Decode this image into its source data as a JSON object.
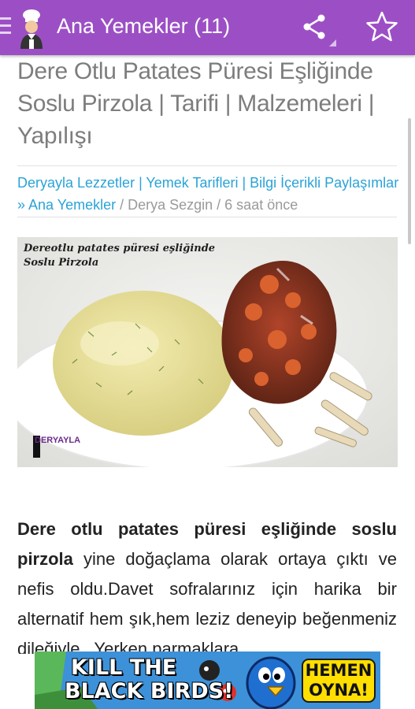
{
  "app": {
    "title": "Ana Yemekler (11)"
  },
  "article": {
    "title": "Dere Otlu Patates Püresi Eşliğinde Soslu Pirzola | Tarifi | Malzemeleri | Yapılışı",
    "meta_link": "Deryayla Lezzetler | Yemek Tarifleri | Bilgi İçerikli Paylaşımlar » Ana Yemekler",
    "meta_rest": " / Derya Sezgin / 6 saat önce",
    "photo": {
      "caption_line1": "Dereotlu patates püresi eşliğinde",
      "caption_line2": "Soslu Pirzola",
      "logo_text": "DERYAYLA"
    },
    "body_bold": "Dere otlu patates püresi eşliğinde soslu pirzola",
    "body_text": " yine doğaçlama olarak ortaya çıktı ve nefis oldu.Davet sofralarınız için harika bir alternatif hem şık,hem leziz deneyip beğenmeniz dileğiyle.. Yerken parmaklara"
  },
  "ad": {
    "headline_line1": "KILL THE",
    "headline_line2": "BLACK BIRDS!",
    "cta_line1": "HEMEN",
    "cta_line2": "OYNA!"
  },
  "colors": {
    "appbar": "#9c4fc5",
    "link": "#2aa3d8",
    "title_gray": "#7d7d7d"
  },
  "icons": [
    "menu-icon",
    "chef-icon",
    "share-icon",
    "star-icon"
  ]
}
